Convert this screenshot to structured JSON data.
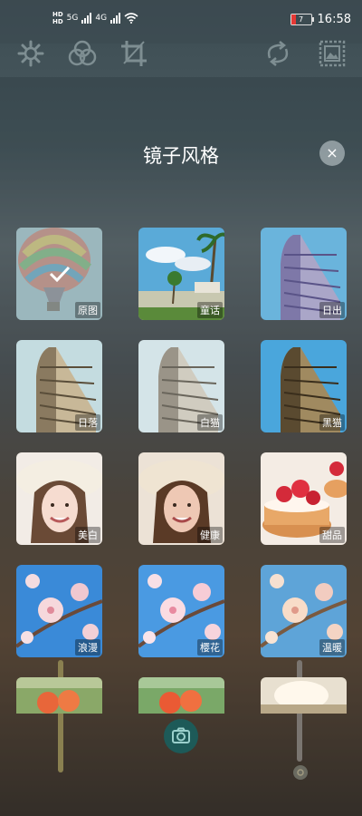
{
  "status_bar": {
    "hd_labels": [
      "HD",
      "HD"
    ],
    "net_1": "5G",
    "net_2": "4G",
    "battery_level": "7",
    "time": "16:58"
  },
  "toolbar": {
    "icons": [
      "gear-icon",
      "filter-icon",
      "crop-icon",
      "rotate-icon",
      "picture-frame-icon"
    ]
  },
  "panel": {
    "title": "镜子风格",
    "close_icon": "×"
  },
  "filters": [
    {
      "label": "原图",
      "selected": true
    },
    {
      "label": "童话",
      "selected": false
    },
    {
      "label": "日出",
      "selected": false
    },
    {
      "label": "日落",
      "selected": false
    },
    {
      "label": "白猫",
      "selected": false
    },
    {
      "label": "黑猫",
      "selected": false
    },
    {
      "label": "美白",
      "selected": false
    },
    {
      "label": "健康",
      "selected": false
    },
    {
      "label": "甜品",
      "selected": false
    },
    {
      "label": "浪漫",
      "selected": false
    },
    {
      "label": "樱花",
      "selected": false
    },
    {
      "label": "温暖",
      "selected": false
    },
    {
      "label": "",
      "selected": false
    },
    {
      "label": "",
      "selected": false
    },
    {
      "label": "",
      "selected": false
    }
  ],
  "colors": {
    "accent": "#1d5a58",
    "icon": "#7e8e92",
    "battery_low": "#e53935"
  }
}
